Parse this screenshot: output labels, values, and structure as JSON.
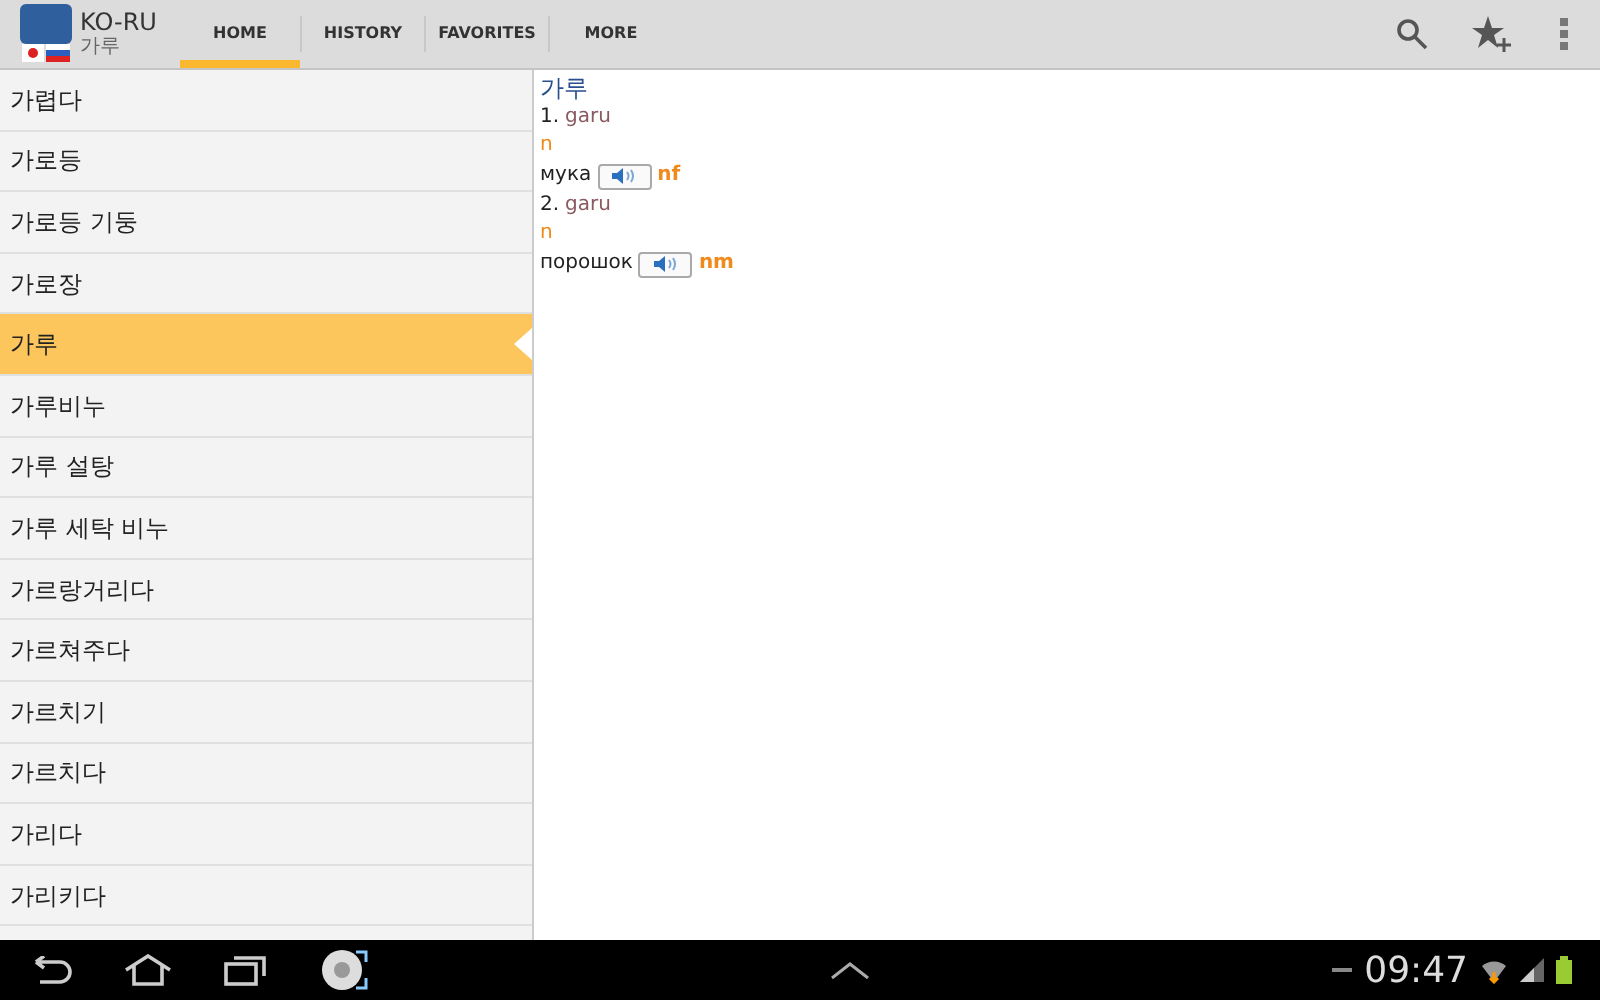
{
  "app": {
    "language_pair": "KO-RU",
    "current_word": "가루"
  },
  "tabs": [
    {
      "label": "HOME",
      "selected": true
    },
    {
      "label": "HISTORY",
      "selected": false
    },
    {
      "label": "FAVORITES",
      "selected": false
    },
    {
      "label": "MORE",
      "selected": false
    }
  ],
  "word_list": [
    {
      "word": "가렵다",
      "selected": false
    },
    {
      "word": "가로등",
      "selected": false
    },
    {
      "word": "가로등 기둥",
      "selected": false
    },
    {
      "word": "가로장",
      "selected": false
    },
    {
      "word": "가루",
      "selected": true
    },
    {
      "word": "가루비누",
      "selected": false
    },
    {
      "word": "가루 설탕",
      "selected": false
    },
    {
      "word": "가루 세탁 비누",
      "selected": false
    },
    {
      "word": "가르랑거리다",
      "selected": false
    },
    {
      "word": "가르쳐주다",
      "selected": false
    },
    {
      "word": "가르치기",
      "selected": false
    },
    {
      "word": "가르치다",
      "selected": false
    },
    {
      "word": "가리다",
      "selected": false
    },
    {
      "word": "가리키다",
      "selected": false
    }
  ],
  "entry": {
    "headword": "가루",
    "senses": [
      {
        "number": "1.",
        "romanization": "garu",
        "pos": "n",
        "translation": "мука",
        "gender": "nf"
      },
      {
        "number": "2.",
        "romanization": "garu",
        "pos": "n",
        "translation": "порошок",
        "gender": "nm"
      }
    ]
  },
  "status_bar": {
    "time": "09:47"
  }
}
